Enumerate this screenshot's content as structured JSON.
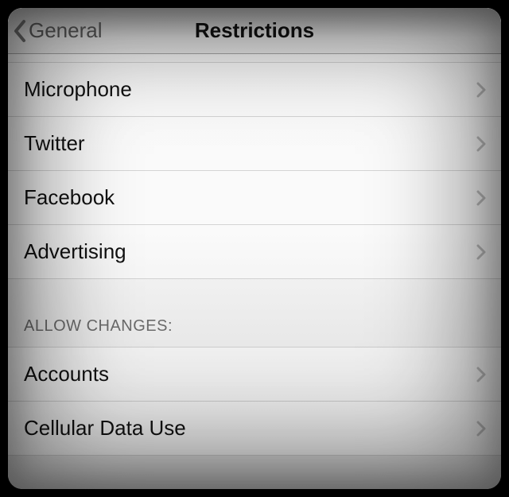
{
  "navbar": {
    "back_label": "General",
    "title": "Restrictions"
  },
  "group1": {
    "items": [
      {
        "label": "Microphone"
      },
      {
        "label": "Twitter"
      },
      {
        "label": "Facebook"
      },
      {
        "label": "Advertising"
      }
    ]
  },
  "section_header": "ALLOW CHANGES:",
  "group2": {
    "items": [
      {
        "label": "Accounts"
      },
      {
        "label": "Cellular Data Use"
      }
    ]
  }
}
